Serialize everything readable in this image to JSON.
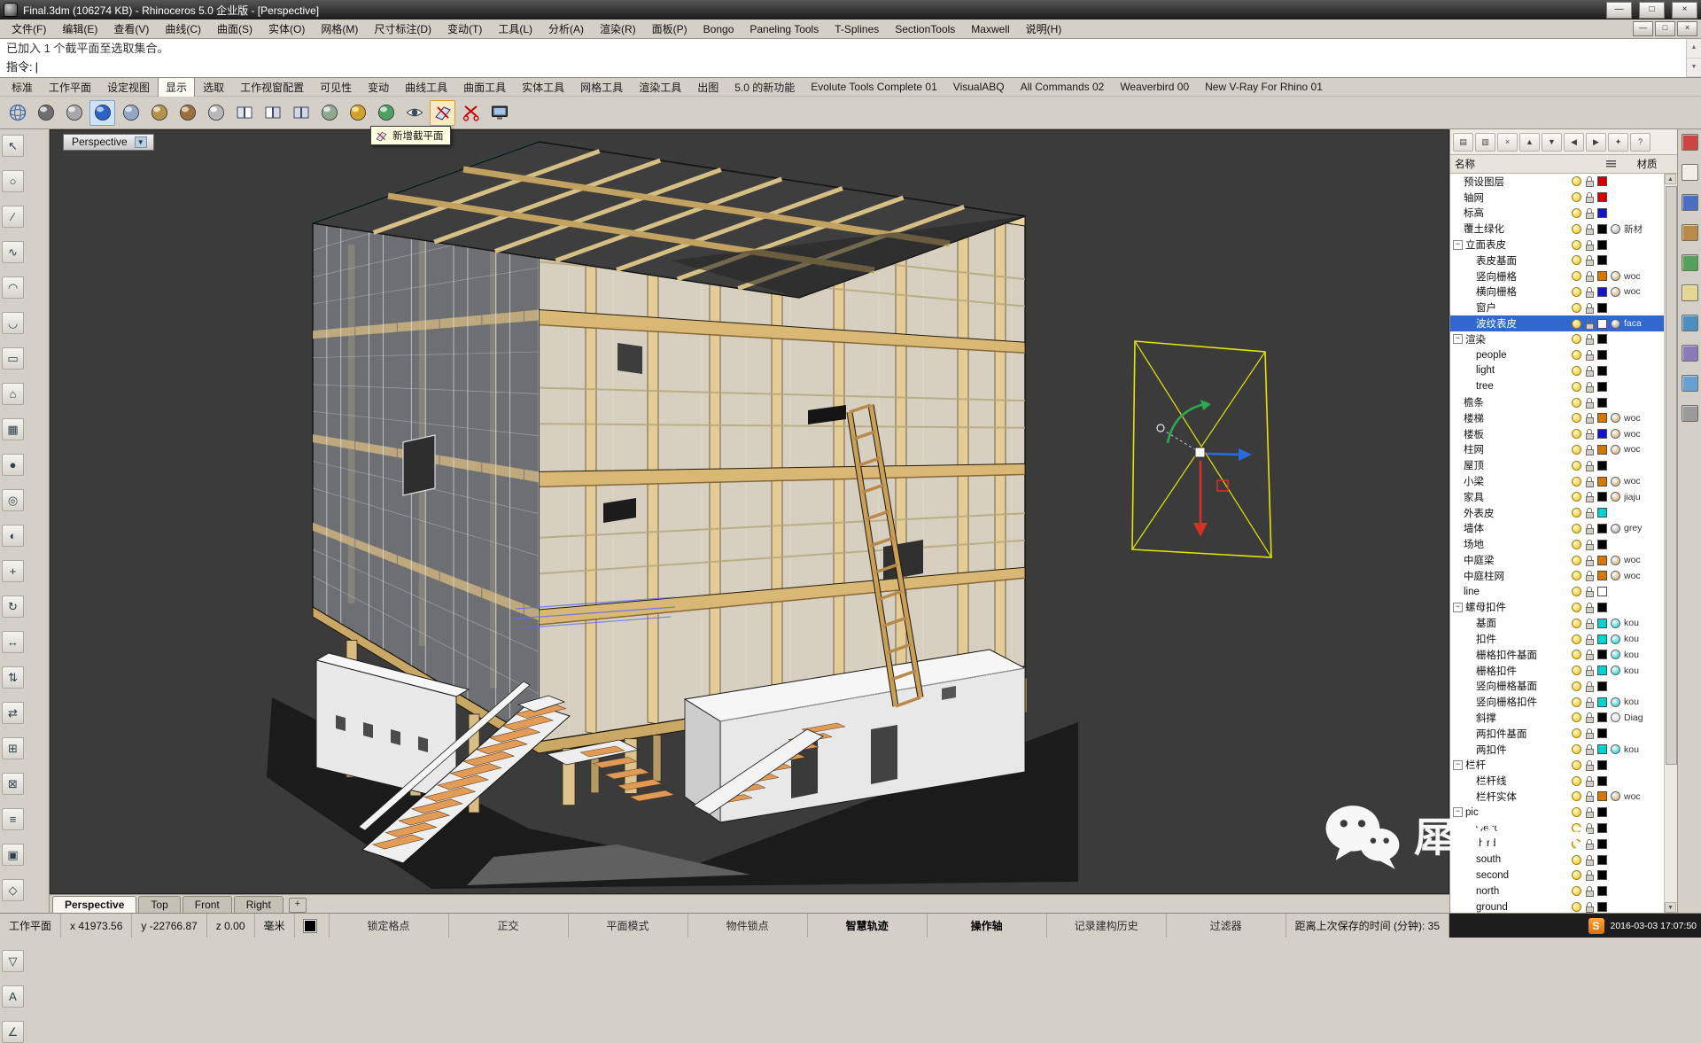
{
  "title_bar": {
    "title": "Final.3dm (106274 KB) - Rhinoceros 5.0 企业版 - [Perspective]",
    "buttons": [
      "—",
      "□",
      "×"
    ]
  },
  "menu_bar": {
    "items": [
      "文件(F)",
      "编辑(E)",
      "查看(V)",
      "曲线(C)",
      "曲面(S)",
      "实体(O)",
      "网格(M)",
      "尺寸标注(D)",
      "变动(T)",
      "工具(L)",
      "分析(A)",
      "渲染(R)",
      "面板(P)",
      "Bongo",
      "Paneling Tools",
      "T-Splines",
      "SectionTools",
      "Maxwell",
      "说明(H)"
    ],
    "window_buttons": [
      "—",
      "□",
      "×"
    ]
  },
  "command": {
    "history": "已加入 1 个截平面至选取集合。",
    "prompt": "指令:",
    "caret": "|"
  },
  "tab_bar": {
    "active": "显示",
    "tabs": [
      "标准",
      "工作平面",
      "设定视图",
      "显示",
      "选取",
      "工作视窗配置",
      "可见性",
      "变动",
      "曲线工具",
      "曲面工具",
      "实体工具",
      "网格工具",
      "渲染工具",
      "出图",
      "5.0 的新功能",
      "Evolute Tools Complete 01",
      "VisualABQ",
      "All Commands 02",
      "Weaverbird 00",
      "New V-Ray For Rhino 01"
    ]
  },
  "toolbar": {
    "icons": [
      "wireframe-view-icon",
      "shaded-view-icon",
      "ghosted-view-icon",
      "rendered-view-icon",
      "xray-view-icon",
      "technical-view-icon",
      "artistic-view-icon",
      "pen-view-icon",
      "viewport-layout-icon",
      "split-horizontal-icon",
      "split-vertical-icon",
      "zoom-extents-icon",
      "shade-selected-icon",
      "backface-view-icon",
      "visibility-eye-icon",
      "add-clipping-plane-icon",
      "remove-clipping-plane-icon",
      "fullscreen-display-icon"
    ],
    "pressed": "rendered-view-icon",
    "highlighted": "add-clipping-plane-icon",
    "tooltip": "新增截平面"
  },
  "left_toolbar": {
    "icons": [
      "pointer-icon",
      "select-brush-icon",
      "line-icon",
      "curve-icon",
      "arc-icon",
      "blend-icon",
      "rectangle-icon",
      "extrude-icon",
      "mesh-icon",
      "sphere-icon",
      "circle-icon",
      "hatch-icon",
      "move-icon",
      "rotate-icon",
      "stretch-icon",
      "align-icon",
      "mirror-icon",
      "array-icon",
      "trim-icon",
      "group-icon",
      "split-icon",
      "points-icon",
      "scale-icon",
      "project-icon",
      "text-icon",
      "dimension-icon"
    ]
  },
  "viewport": {
    "label": "Perspective",
    "tabs": [
      "Perspective",
      "Top",
      "Front",
      "Right"
    ],
    "active_tab": "Perspective",
    "add_tab_glyph": "+"
  },
  "layers_panel": {
    "header_name": "名称",
    "header_material": "材质",
    "toolbar_icons": [
      "new-layer-icon",
      "new-sublayer-icon",
      "delete-layer-icon",
      "move-up-icon",
      "move-down-icon",
      "collapse-all-icon",
      "expand-all-icon",
      "layer-tools-icon",
      "help-icon"
    ],
    "layers": [
      {
        "name": "预设图层",
        "indent": 0,
        "color": "#d40000"
      },
      {
        "name": "轴网",
        "indent": 0,
        "color": "#d40000"
      },
      {
        "name": "标高",
        "indent": 0,
        "color": "#1414c8"
      },
      {
        "name": "覆土绿化",
        "indent": 0,
        "color": "#000000",
        "material": "新材",
        "mat_color": "#a8a8a8"
      },
      {
        "name": "立面表皮",
        "indent": 0,
        "group": true,
        "color": "#000000"
      },
      {
        "name": "表皮基面",
        "indent": 1,
        "color": "#000000"
      },
      {
        "name": "竖向栅格",
        "indent": 1,
        "color": "#d47800",
        "material": "woc",
        "mat_color": "#c8a060"
      },
      {
        "name": "横向栅格",
        "indent": 1,
        "color": "#1414c8",
        "material": "woc",
        "mat_color": "#c8a060"
      },
      {
        "name": "窗户",
        "indent": 1,
        "color": "#000000"
      },
      {
        "name": "波纹表皮",
        "indent": 1,
        "color": "#ffffff",
        "material": "faca",
        "mat_color": "#909090",
        "selected": true
      },
      {
        "name": "渲染",
        "indent": 0,
        "group": true,
        "color": "#000000"
      },
      {
        "name": "people",
        "indent": 1,
        "color": "#000000"
      },
      {
        "name": "light",
        "indent": 1,
        "color": "#000000"
      },
      {
        "name": "tree",
        "indent": 1,
        "color": "#000000"
      },
      {
        "name": "檐条",
        "indent": 0,
        "color": "#000000"
      },
      {
        "name": "楼梯",
        "indent": 0,
        "color": "#d47800",
        "material": "woc",
        "mat_color": "#c8a060"
      },
      {
        "name": "楼板",
        "indent": 0,
        "color": "#1414c8",
        "material": "woc",
        "mat_color": "#c8a060"
      },
      {
        "name": "柱网",
        "indent": 0,
        "color": "#d47800",
        "material": "woc",
        "mat_color": "#c8a060"
      },
      {
        "name": "屋顶",
        "indent": 0,
        "color": "#000000"
      },
      {
        "name": "小梁",
        "indent": 0,
        "color": "#d47800",
        "material": "woc",
        "mat_color": "#c8a060"
      },
      {
        "name": "家具",
        "indent": 0,
        "color": "#000000",
        "material": "jiaju",
        "mat_color": "#c8a060"
      },
      {
        "name": "外表皮",
        "indent": 0,
        "color": "#00d2d2"
      },
      {
        "name": "墙体",
        "indent": 0,
        "color": "#000000",
        "material": "grey",
        "mat_color": "#9a9a9a"
      },
      {
        "name": "场地",
        "indent": 0,
        "color": "#000000"
      },
      {
        "name": "中庭梁",
        "indent": 0,
        "color": "#d47800",
        "material": "woc",
        "mat_color": "#c8a060"
      },
      {
        "name": "中庭柱网",
        "indent": 0,
        "color": "#d47800",
        "material": "woc",
        "mat_color": "#c8a060"
      },
      {
        "name": "line",
        "indent": 0,
        "color": "#ffffff"
      },
      {
        "name": "螺母扣件",
        "indent": 0,
        "group": true,
        "color": "#000000"
      },
      {
        "name": "基面",
        "indent": 1,
        "color": "#00d2d2",
        "material": "kou",
        "mat_color": "#00c8c8"
      },
      {
        "name": "扣件",
        "indent": 1,
        "color": "#00d2d2",
        "material": "kou",
        "mat_color": "#00c8c8"
      },
      {
        "name": "栅格扣件基面",
        "indent": 1,
        "color": "#000000",
        "material": "kou",
        "mat_color": "#00c8c8"
      },
      {
        "name": "栅格扣件",
        "indent": 1,
        "color": "#00d2d2",
        "material": "kou",
        "mat_color": "#00c8c8"
      },
      {
        "name": "竖向栅格基面",
        "indent": 1,
        "color": "#000000"
      },
      {
        "name": "竖向栅格扣件",
        "indent": 1,
        "color": "#00d2d2",
        "material": "kou",
        "mat_color": "#00c8c8"
      },
      {
        "name": "斜撑",
        "indent": 1,
        "color": "#000000",
        "material": "Diag",
        "mat_color": "#d8d8d8"
      },
      {
        "name": "两扣件基面",
        "indent": 1,
        "color": "#000000"
      },
      {
        "name": "两扣件",
        "indent": 1,
        "color": "#00d2d2",
        "material": "kou",
        "mat_color": "#00c8c8"
      },
      {
        "name": "栏杆",
        "indent": 0,
        "group": true,
        "color": "#000000"
      },
      {
        "name": "栏杆线",
        "indent": 1,
        "color": "#000000"
      },
      {
        "name": "栏杆实体",
        "indent": 1,
        "color": "#d47800",
        "material": "woc",
        "mat_color": "#c8a060"
      },
      {
        "name": "pic",
        "indent": 0,
        "group": true,
        "color": "#000000"
      },
      {
        "name": "west",
        "indent": 1,
        "color": "#000000"
      },
      {
        "name": "third",
        "indent": 1,
        "color": "#000000"
      },
      {
        "name": "south",
        "indent": 1,
        "color": "#000000"
      },
      {
        "name": "second",
        "indent": 1,
        "color": "#000000"
      },
      {
        "name": "north",
        "indent": 1,
        "color": "#000000"
      },
      {
        "name": "ground",
        "indent": 1,
        "color": "#000000"
      }
    ]
  },
  "edge_strip": {
    "icons": [
      "properties-panel-icon",
      "layers-panel-icon",
      "display-panel-icon",
      "materials-panel-icon",
      "named-views-panel-icon",
      "notes-panel-icon",
      "help-panel-icon",
      "libraries-panel-icon",
      "web-panel-icon",
      "calculator-panel-icon"
    ]
  },
  "status_bar": {
    "cplane": "工作平面",
    "x": "x 41973.56",
    "y": "y -22766.87",
    "z": "z 0.00",
    "units": "毫米",
    "toggles": [
      {
        "label": "锁定格点",
        "active": false
      },
      {
        "label": "正交",
        "active": false
      },
      {
        "label": "平面模式",
        "active": false
      },
      {
        "label": "物件锁点",
        "active": false
      },
      {
        "label": "智慧轨迹",
        "active": true
      },
      {
        "label": "操作轴",
        "active": true
      },
      {
        "label": "记录建构历史",
        "active": false
      },
      {
        "label": "过滤器",
        "active": false
      }
    ],
    "save_time": "距离上次保存的时间 (分钟): 35",
    "logo_letter": "S",
    "timestamp": "2016-03-03 17:07:50"
  },
  "watermark": {
    "text": "犀流觞报"
  },
  "colors": {
    "selection_highlight": "#3167ce",
    "gumball_frame": "#e4e400",
    "axis_x_red": "#d93025",
    "axis_y_green": "#2fa84f",
    "axis_z_blue": "#2b6bdd",
    "wood": "#d9b876",
    "viewport_background": "#3b3b3b"
  }
}
